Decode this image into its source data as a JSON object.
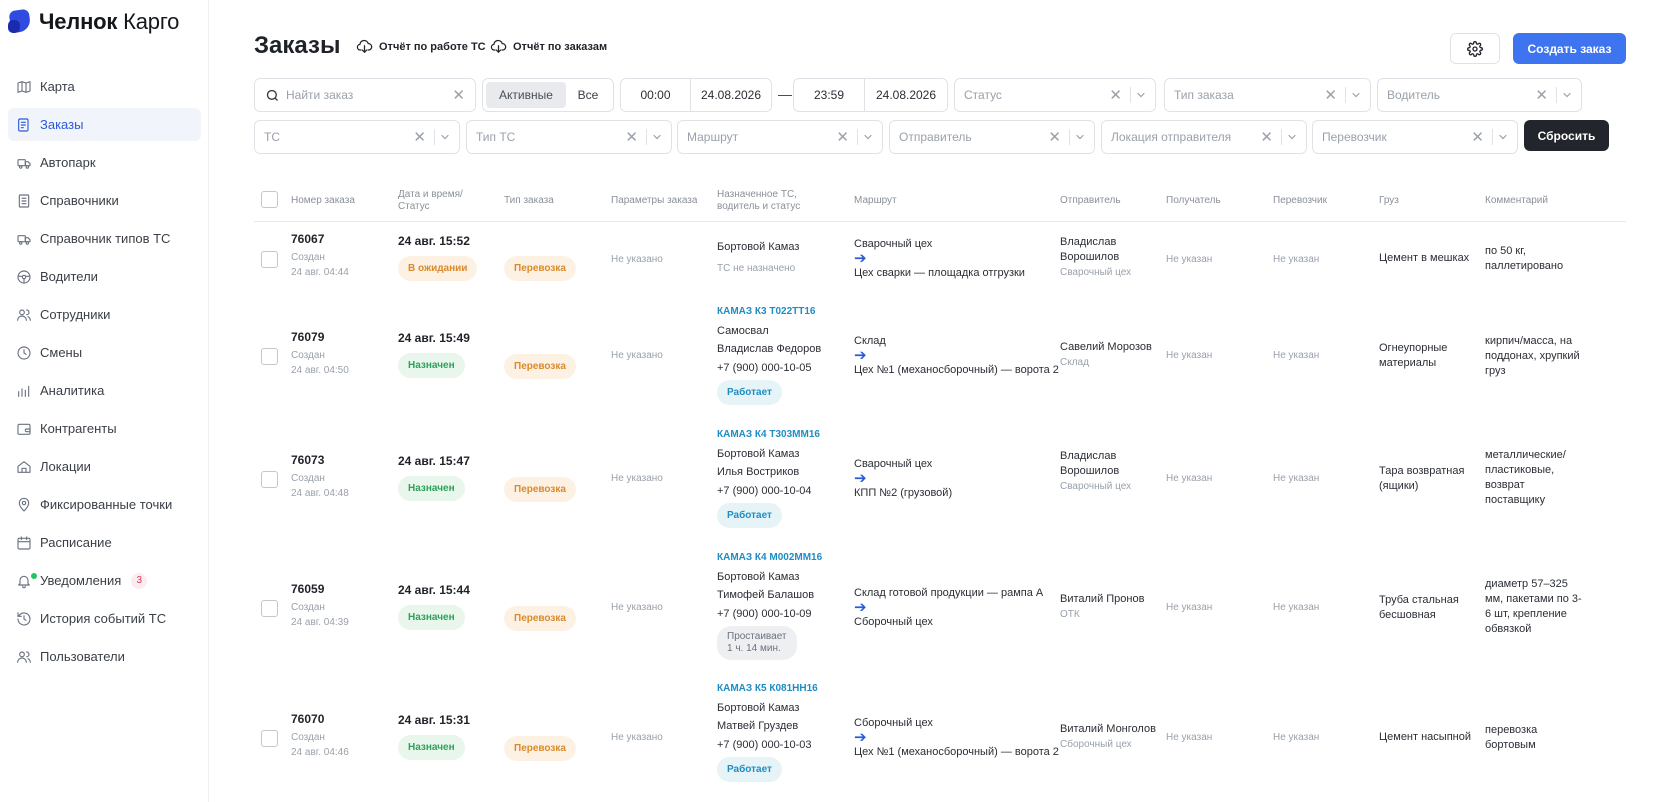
{
  "brand": {
    "bold": "Челнок",
    "light": " Карго"
  },
  "nav": [
    {
      "label": "Карта",
      "icon": "map-icon"
    },
    {
      "label": "Заказы",
      "icon": "orders-icon",
      "active": true
    },
    {
      "label": "Автопарк",
      "icon": "truck-icon"
    },
    {
      "label": "Справочники",
      "icon": "book-icon"
    },
    {
      "label": "Справочник типов ТС",
      "icon": "truck-types-icon"
    },
    {
      "label": "Водители",
      "icon": "steering-wheel-icon"
    },
    {
      "label": "Сотрудники",
      "icon": "users-icon"
    },
    {
      "label": "Смены",
      "icon": "clock-icon"
    },
    {
      "label": "Аналитика",
      "icon": "bar-chart-icon"
    },
    {
      "label": "Контрагенты",
      "icon": "wallet-icon"
    },
    {
      "label": "Локации",
      "icon": "home-icon"
    },
    {
      "label": "Фиксированные точки",
      "icon": "pin-icon"
    },
    {
      "label": "Расписание",
      "icon": "calendar-icon"
    },
    {
      "label": "Уведомления",
      "icon": "bell-icon",
      "badge": "3"
    },
    {
      "label": "История событий ТС",
      "icon": "history-icon"
    },
    {
      "label": "Пользователи",
      "icon": "user-group-icon"
    }
  ],
  "header": {
    "title": "Заказы",
    "report_vehicles": "Отчёт по работе ТС",
    "report_orders": "Отчёт по заказам",
    "create": "Создать заказ"
  },
  "filters": {
    "search_placeholder": "Найти заказ",
    "seg_active": "Активные",
    "seg_all": "Все",
    "time_from": "00:00",
    "date_from": "24.08.2026",
    "dash": "—",
    "time_to": "23:59",
    "date_to": "24.08.2026",
    "status": "Статус",
    "order_type": "Тип заказа",
    "driver": "Водитель",
    "vehicle": "ТС",
    "vehicle_type": "Тип ТС",
    "route": "Маршрут",
    "sender": "Отправитель",
    "sender_location": "Локация отправителя",
    "carrier": "Перевозчик",
    "reset": "Сбросить"
  },
  "columns": {
    "number": "Номер заказа",
    "datetime1": "Дата и время/",
    "datetime2": "Статус",
    "type": "Тип заказа",
    "params": "Параметры заказа",
    "assigned1": "Назначенное ТС,",
    "assigned2": "водитель и статус",
    "route": "Маршрут",
    "sender": "Отправитель",
    "receiver": "Получатель",
    "carrier": "Перевозчик",
    "cargo": "Груз",
    "comment": "Комментарий"
  },
  "orders": [
    {
      "number": "76067",
      "created_label": "Создан",
      "created": "24 авг. 04:44",
      "datetime": "24 авг. 15:52",
      "status": "В ожидании",
      "type": "Перевозка",
      "params": "Не указано",
      "vehicle": "Бортовой Камаз",
      "vehicle_note": "ТС не назначено",
      "route_from": "Сварочный цех",
      "route_to": "Цех сварки — площадка отгрузки",
      "sender_name1": "Владислав",
      "sender_name2": "Ворошилов",
      "sender_loc": "Сварочный цех",
      "receiver": "Не указан",
      "carrier": "Не указан",
      "cargo": "Цемент в мешках",
      "comment1": "по 50 кг,",
      "comment2": "паллетировано"
    },
    {
      "number": "76079",
      "created_label": "Создан",
      "created": "24 авг. 04:50",
      "datetime": "24 авг. 15:49",
      "status": "Назначен",
      "type": "Перевозка",
      "params": "Не указано",
      "vehicle_link": "КАМАЗ К3 Т022ТТ16",
      "vehicle": "Самосвал",
      "driver": "Владислав Федоров",
      "phone": "+7 (900) 000-10-05",
      "work_status": "Работает",
      "route_from": "Склад",
      "route_to": "Цех №1 (механосборочный) — ворота 2",
      "sender_name1": "Савелий Морозов",
      "sender_loc": "Склад",
      "receiver": "Не указан",
      "carrier": "Не указан",
      "cargo1": "Огнеупорные",
      "cargo2": "материалы",
      "comment1": "кирпич/масса, на",
      "comment2": "поддонах, хрупкий",
      "comment3": "груз"
    },
    {
      "number": "76073",
      "created_label": "Создан",
      "created": "24 авг. 04:48",
      "datetime": "24 авг. 15:47",
      "status": "Назначен",
      "type": "Перевозка",
      "params": "Не указано",
      "vehicle_link": "КАМАЗ К4 Т303ММ16",
      "vehicle": "Бортовой Камаз",
      "driver": "Илья Востриков",
      "phone": "+7 (900) 000-10-04",
      "work_status": "Работает",
      "route_from": "Сварочный цех",
      "route_to": "КПП №2 (грузовой)",
      "sender_name1": "Владислав",
      "sender_name2": "Ворошилов",
      "sender_loc": "Сварочный цех",
      "receiver": "Не указан",
      "carrier": "Не указан",
      "cargo1": "Тара возвратная",
      "cargo2": "(ящики)",
      "comment1": "металлические/",
      "comment2": "пластиковые,",
      "comment3": "возврат",
      "comment4": "поставщику"
    },
    {
      "number": "76059",
      "created_label": "Создан",
      "created": "24 авг. 04:39",
      "datetime": "24 авг. 15:44",
      "status": "Назначен",
      "type": "Перевозка",
      "params": "Не указано",
      "vehicle_link": "КАМАЗ К4 М002ММ16",
      "vehicle": "Бортовой Камаз",
      "driver": "Тимофей Балашов",
      "phone": "+7 (900) 000-10-09",
      "idle1": "Простаивает",
      "idle2": "1 ч. 14 мин.",
      "route_from": "Склад готовой продукции — рампа А",
      "route_to": "Сборочный цех",
      "sender_name1": "Виталий Пронов",
      "sender_loc": "ОТК",
      "receiver": "Не указан",
      "carrier": "Не указан",
      "cargo1": "Труба стальная",
      "cargo2": "бесшовная",
      "comment1": "диаметр 57–325",
      "comment2": "мм, пакетами по 3-",
      "comment3": "6 шт, крепление",
      "comment4": "обвязкой"
    },
    {
      "number": "76070",
      "created_label": "Создан",
      "created": "24 авг. 04:46",
      "datetime": "24 авг. 15:31",
      "status": "Назначен",
      "type": "Перевозка",
      "params": "Не указано",
      "vehicle_link": "КАМАЗ К5 К081НН16",
      "vehicle": "Бортовой Камаз",
      "driver": "Матвей Груздев",
      "phone": "+7 (900) 000-10-03",
      "work_status": "Работает",
      "route_from": "Сборочный цех",
      "route_to": "Цех №1 (механосборочный) — ворота 2",
      "sender_name1": "Виталий Монголов",
      "sender_loc": "Сборочный цех",
      "receiver": "Не указан",
      "carrier": "Не указан",
      "cargo": "Цемент насыпной",
      "comment1": "перевозка",
      "comment2": "бортовым"
    }
  ]
}
